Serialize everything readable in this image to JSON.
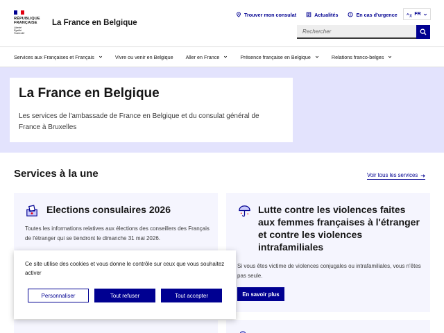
{
  "brand": {
    "logo_lines": [
      "RÉPUBLIQUE",
      "FRANÇAISE"
    ],
    "logo_motto": [
      "Liberté",
      "Égalité",
      "Fraternité"
    ],
    "flag_colors": [
      "#000091",
      "#ffffff",
      "#e1000f"
    ],
    "site_title": "La France en Belgique"
  },
  "header": {
    "quick_links": [
      {
        "label": "Trouver mon consulat",
        "icon": "map-pin-icon"
      },
      {
        "label": "Actualités",
        "icon": "newspaper-icon"
      },
      {
        "label": "En cas d'urgence",
        "icon": "info-icon"
      }
    ],
    "language": "FR",
    "search_placeholder": "Rechercher"
  },
  "nav": {
    "items": [
      {
        "label": "Services aux Françaises et Français",
        "has_dropdown": true
      },
      {
        "label": "Vivre ou venir en Belgique",
        "has_dropdown": false
      },
      {
        "label": "Aller en France",
        "has_dropdown": true
      },
      {
        "label": "Présence française en Belgique",
        "has_dropdown": true
      },
      {
        "label": "Relations franco-belges",
        "has_dropdown": true
      }
    ]
  },
  "hero": {
    "title": "La France en Belgique",
    "description": "Les services de l'ambassade de France en Belgique et du consulat général de France à Bruxelles"
  },
  "services": {
    "title": "Services à la une",
    "see_all": "Voir tous les services",
    "cards": [
      {
        "icon": "ballot-box-icon",
        "title": "Elections consulaires 2026",
        "description": "Toutes les informations relatives aux élections des conseillers des Français de l'étranger qui se tiendront le dimanche 31 mai 2026."
      },
      {
        "icon": "umbrella-icon",
        "title": "Lutte contre les violences faites aux femmes françaises à l'étranger et contre les violences intrafamiliales",
        "description": "Si vous êtes victime de violences conjugales ou intrafamiliales, vous n'êtes pas seule.",
        "button": "En savoir plus"
      }
    ]
  },
  "cookie": {
    "text": "Ce site utilise des cookies et vous donne le contrôle sur ceux que vous souhaitez activer",
    "buttons": {
      "customize": "Personnaliser",
      "refuse": "Tout refuser",
      "accept": "Tout accepter"
    }
  },
  "colors": {
    "primary": "#000091",
    "hero_bg": "#e3e3fd",
    "card_bg": "#f5f5fe"
  }
}
